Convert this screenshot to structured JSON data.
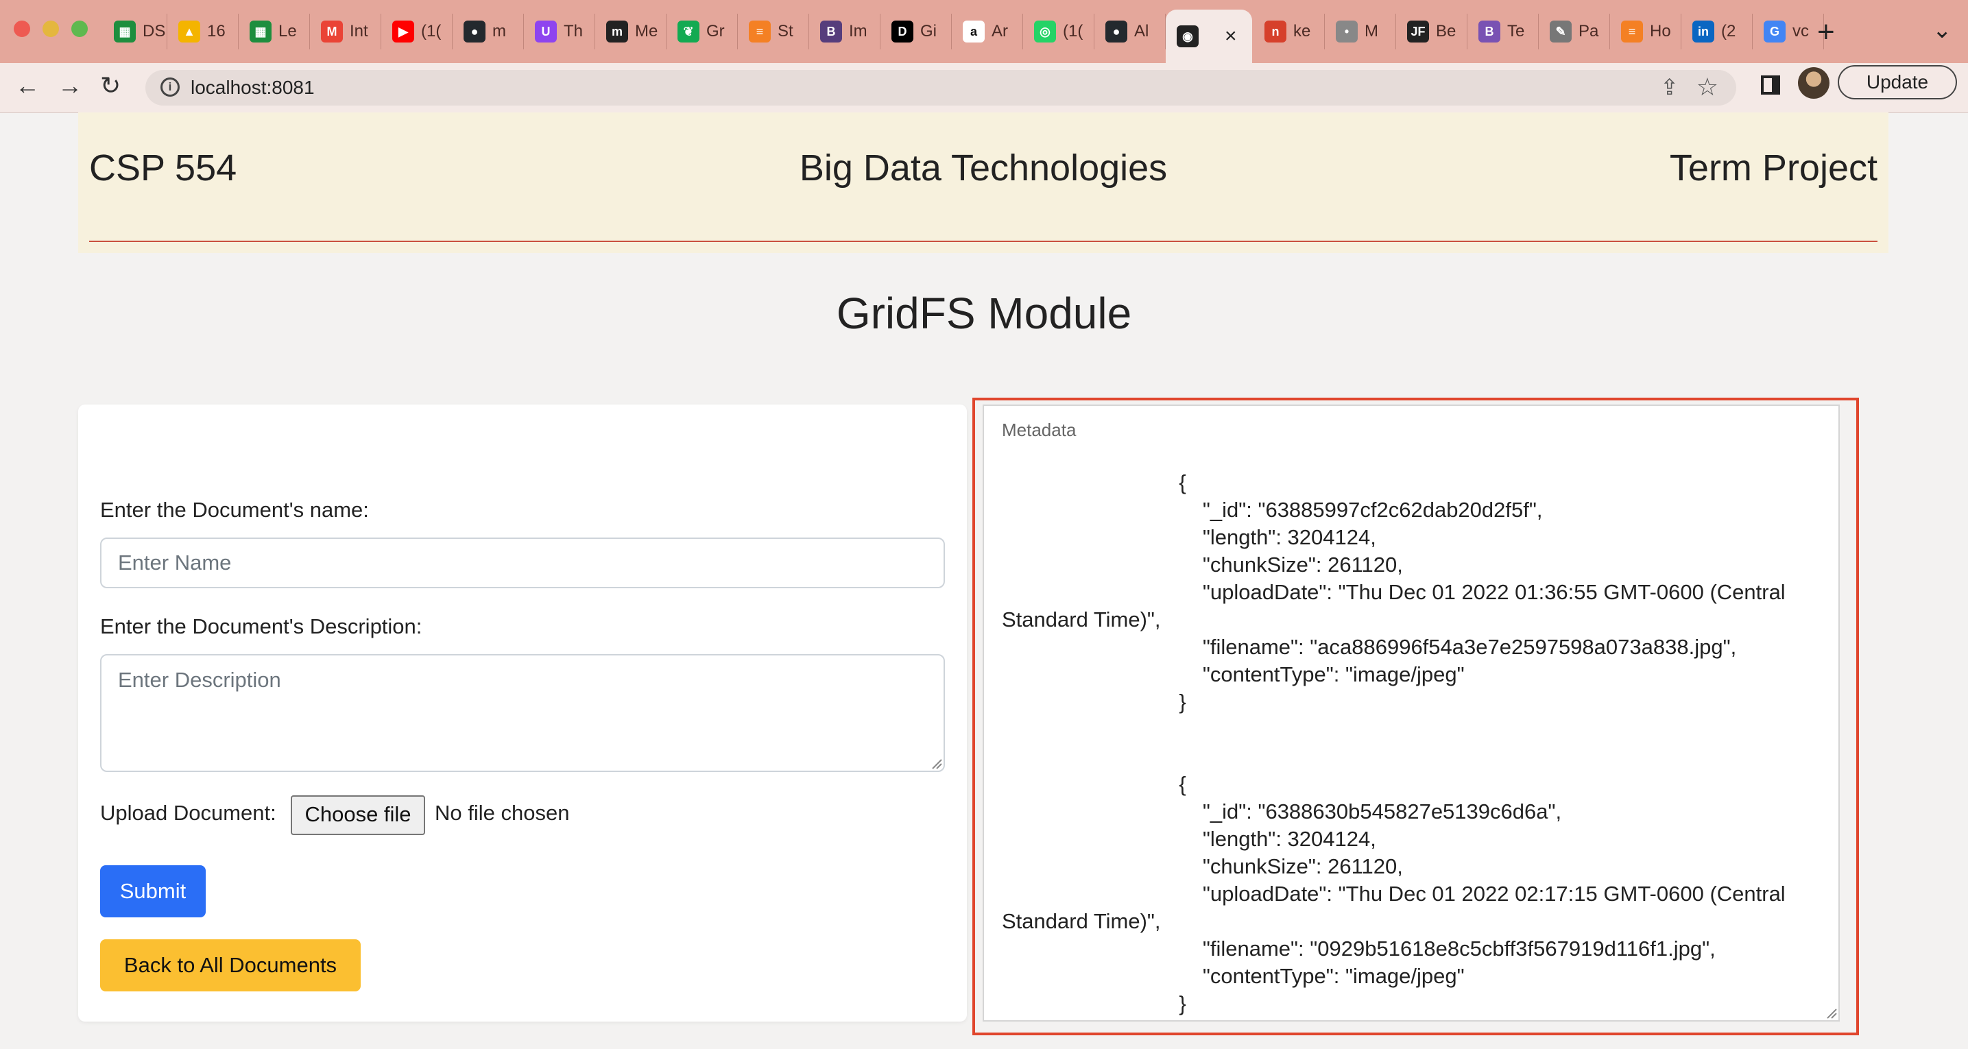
{
  "browser": {
    "tabs": [
      {
        "label": "DS",
        "icon": "sheets-icon",
        "color": "#1e8e3e"
      },
      {
        "label": "16",
        "icon": "drive-icon",
        "color": "#f4b400"
      },
      {
        "label": "Le",
        "icon": "sheets-icon",
        "color": "#1e8e3e"
      },
      {
        "label": "Int",
        "icon": "gmail-icon",
        "color": "#ea4335"
      },
      {
        "label": "(1(",
        "icon": "youtube-icon",
        "color": "#ff0000"
      },
      {
        "label": "m",
        "icon": "github-icon",
        "color": "#24292e"
      },
      {
        "label": "Th",
        "icon": "u-icon",
        "color": "#8e44ef"
      },
      {
        "label": "Me",
        "icon": "m-icon",
        "color": "#222222"
      },
      {
        "label": "Gr",
        "icon": "mongodb-icon",
        "color": "#13aa52"
      },
      {
        "label": "St",
        "icon": "stackoverflow-icon",
        "color": "#f48024"
      },
      {
        "label": "Im",
        "icon": "bootstrap-icon",
        "color": "#563d7c"
      },
      {
        "label": "Gi",
        "icon": "dev-icon",
        "color": "#000000"
      },
      {
        "label": "Ar",
        "icon": "amazon-icon",
        "color": "#ffffff"
      },
      {
        "label": "(1(",
        "icon": "whatsapp-icon",
        "color": "#25d366"
      },
      {
        "label": "Al",
        "icon": "github-icon",
        "color": "#24292e"
      },
      {
        "label": "",
        "icon": "globe-icon",
        "color": "#222222",
        "active": true
      },
      {
        "label": "ke",
        "icon": "n-icon",
        "color": "#d6402b"
      },
      {
        "label": "M",
        "icon": "apple-icon",
        "color": "#888888"
      },
      {
        "label": "Be",
        "icon": "jf-icon",
        "color": "#222222"
      },
      {
        "label": "Te",
        "icon": "bootstrap-icon",
        "color": "#7952b3"
      },
      {
        "label": "Pa",
        "icon": "feather-icon",
        "color": "#777777"
      },
      {
        "label": "Ho",
        "icon": "stackoverflow-icon",
        "color": "#f48024"
      },
      {
        "label": "(2",
        "icon": "linkedin-icon",
        "color": "#0a66c2"
      },
      {
        "label": "vc",
        "icon": "google-icon",
        "color": "#4285f4"
      }
    ],
    "new_tab_symbol": "+",
    "tab_list_symbol": "⌄",
    "url": "localhost:8081",
    "update_label": "Update",
    "tab_close_symbol": "×"
  },
  "header": {
    "left": "CSP 554",
    "center": "Big Data Technologies",
    "right": "Term Project"
  },
  "page_title": "GridFS Module",
  "form": {
    "name_label": "Enter the Document's name:",
    "name_placeholder": "Enter Name",
    "description_label": "Enter the Document's Description:",
    "description_placeholder": "Enter Description",
    "upload_label": "Upload Document:",
    "choose_file_label": "Choose file",
    "no_file_text": "No file chosen",
    "submit_label": "Submit",
    "back_label": "Back to All Documents"
  },
  "metadata": {
    "label": "Metadata",
    "content": "                              {\n                                  \"_id\": \"63885997cf2c62dab20d2f5f\",\n                                  \"length\": 3204124,\n                                  \"chunkSize\": 261120,\n                                  \"uploadDate\": \"Thu Dec 01 2022 01:36:55 GMT-0600 (Central Standard Time)\",\n                                  \"filename\": \"aca886996f54a3e7e2597598a073a838.jpg\",\n                                  \"contentType\": \"image/jpeg\"\n                              }\n\n\n                              {\n                                  \"_id\": \"6388630b545827e5139c6d6a\",\n                                  \"length\": 3204124,\n                                  \"chunkSize\": 261120,\n                                  \"uploadDate\": \"Thu Dec 01 2022 02:17:15 GMT-0600 (Central Standard Time)\",\n                                  \"filename\": \"0929b51618e8c5cbff3f567919d116f1.jpg\",\n                                  \"contentType\": \"image/jpeg\"\n                              }"
  },
  "colors": {
    "tabstrip": "#e4a79b",
    "header_bg": "#f7f1dd",
    "header_rule": "#c9503e",
    "submit": "#2a6ef6",
    "back": "#fbbf31",
    "highlight": "#e0462d"
  }
}
